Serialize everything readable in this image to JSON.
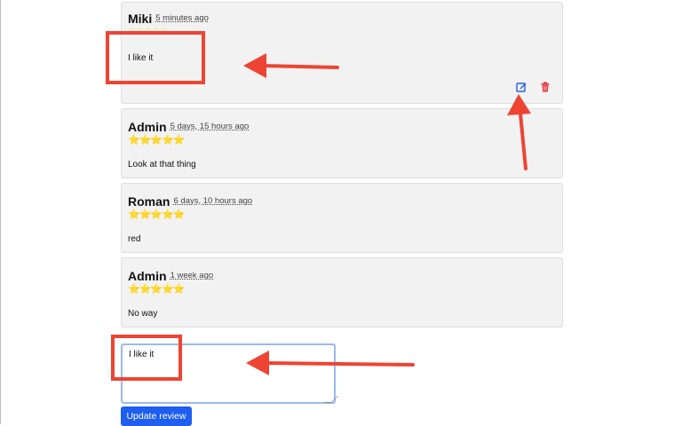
{
  "reviews": [
    {
      "author": "Miki",
      "time": "5 minutes ago",
      "stars": "☆☆☆☆☆",
      "text": "I like it"
    },
    {
      "author": "Admin",
      "time": "5 days, 15 hours ago",
      "stars": "⭐⭐⭐⭐⭐",
      "text": "Look at that thing"
    },
    {
      "author": "Roman",
      "time": "6 days, 10 hours ago",
      "stars": "⭐⭐⭐⭐⭐",
      "text": "red"
    },
    {
      "author": "Admin",
      "time": "1 week ago",
      "stars": "⭐⭐⭐⭐⭐",
      "text": "No way"
    }
  ],
  "actions": {
    "edit_icon": "edit-icon",
    "delete_icon": "trash-icon",
    "edit_color": "#1e5ef0",
    "delete_color": "#e0323c"
  },
  "editor": {
    "value": "I like it",
    "submit_label": "Update review"
  },
  "annotation_color": "#ee4433"
}
